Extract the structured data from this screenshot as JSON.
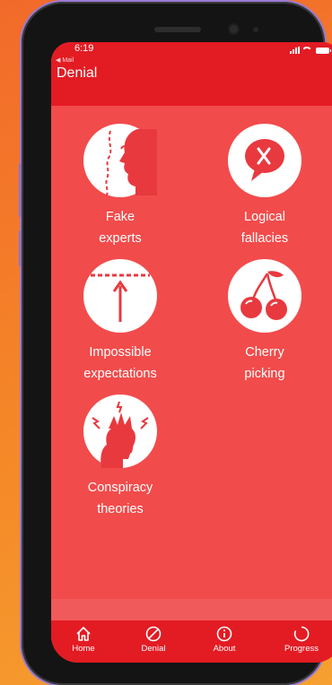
{
  "status_bar": {
    "time": "6:19",
    "back_app": "◀ Mail"
  },
  "header": {
    "title": "Denial"
  },
  "tiles": [
    {
      "line1": "Fake",
      "line2": "experts",
      "icon": "fake-experts-icon"
    },
    {
      "line1": "Logical",
      "line2": "fallacies",
      "icon": "logical-fallacies-icon"
    },
    {
      "line1": "Impossible",
      "line2": "expectations",
      "icon": "impossible-expectations-icon"
    },
    {
      "line1": "Cherry",
      "line2": "picking",
      "icon": "cherry-picking-icon"
    },
    {
      "line1": "Conspiracy",
      "line2": "theories",
      "icon": "conspiracy-theories-icon"
    }
  ],
  "nav": [
    {
      "label": "Home",
      "icon": "home-icon"
    },
    {
      "label": "Denial",
      "icon": "denial-icon"
    },
    {
      "label": "About",
      "icon": "info-icon"
    },
    {
      "label": "Progress",
      "icon": "progress-icon"
    }
  ],
  "colors": {
    "primary": "#e31b23",
    "background": "#f24b4b",
    "icon_fill": "#e8393f"
  }
}
